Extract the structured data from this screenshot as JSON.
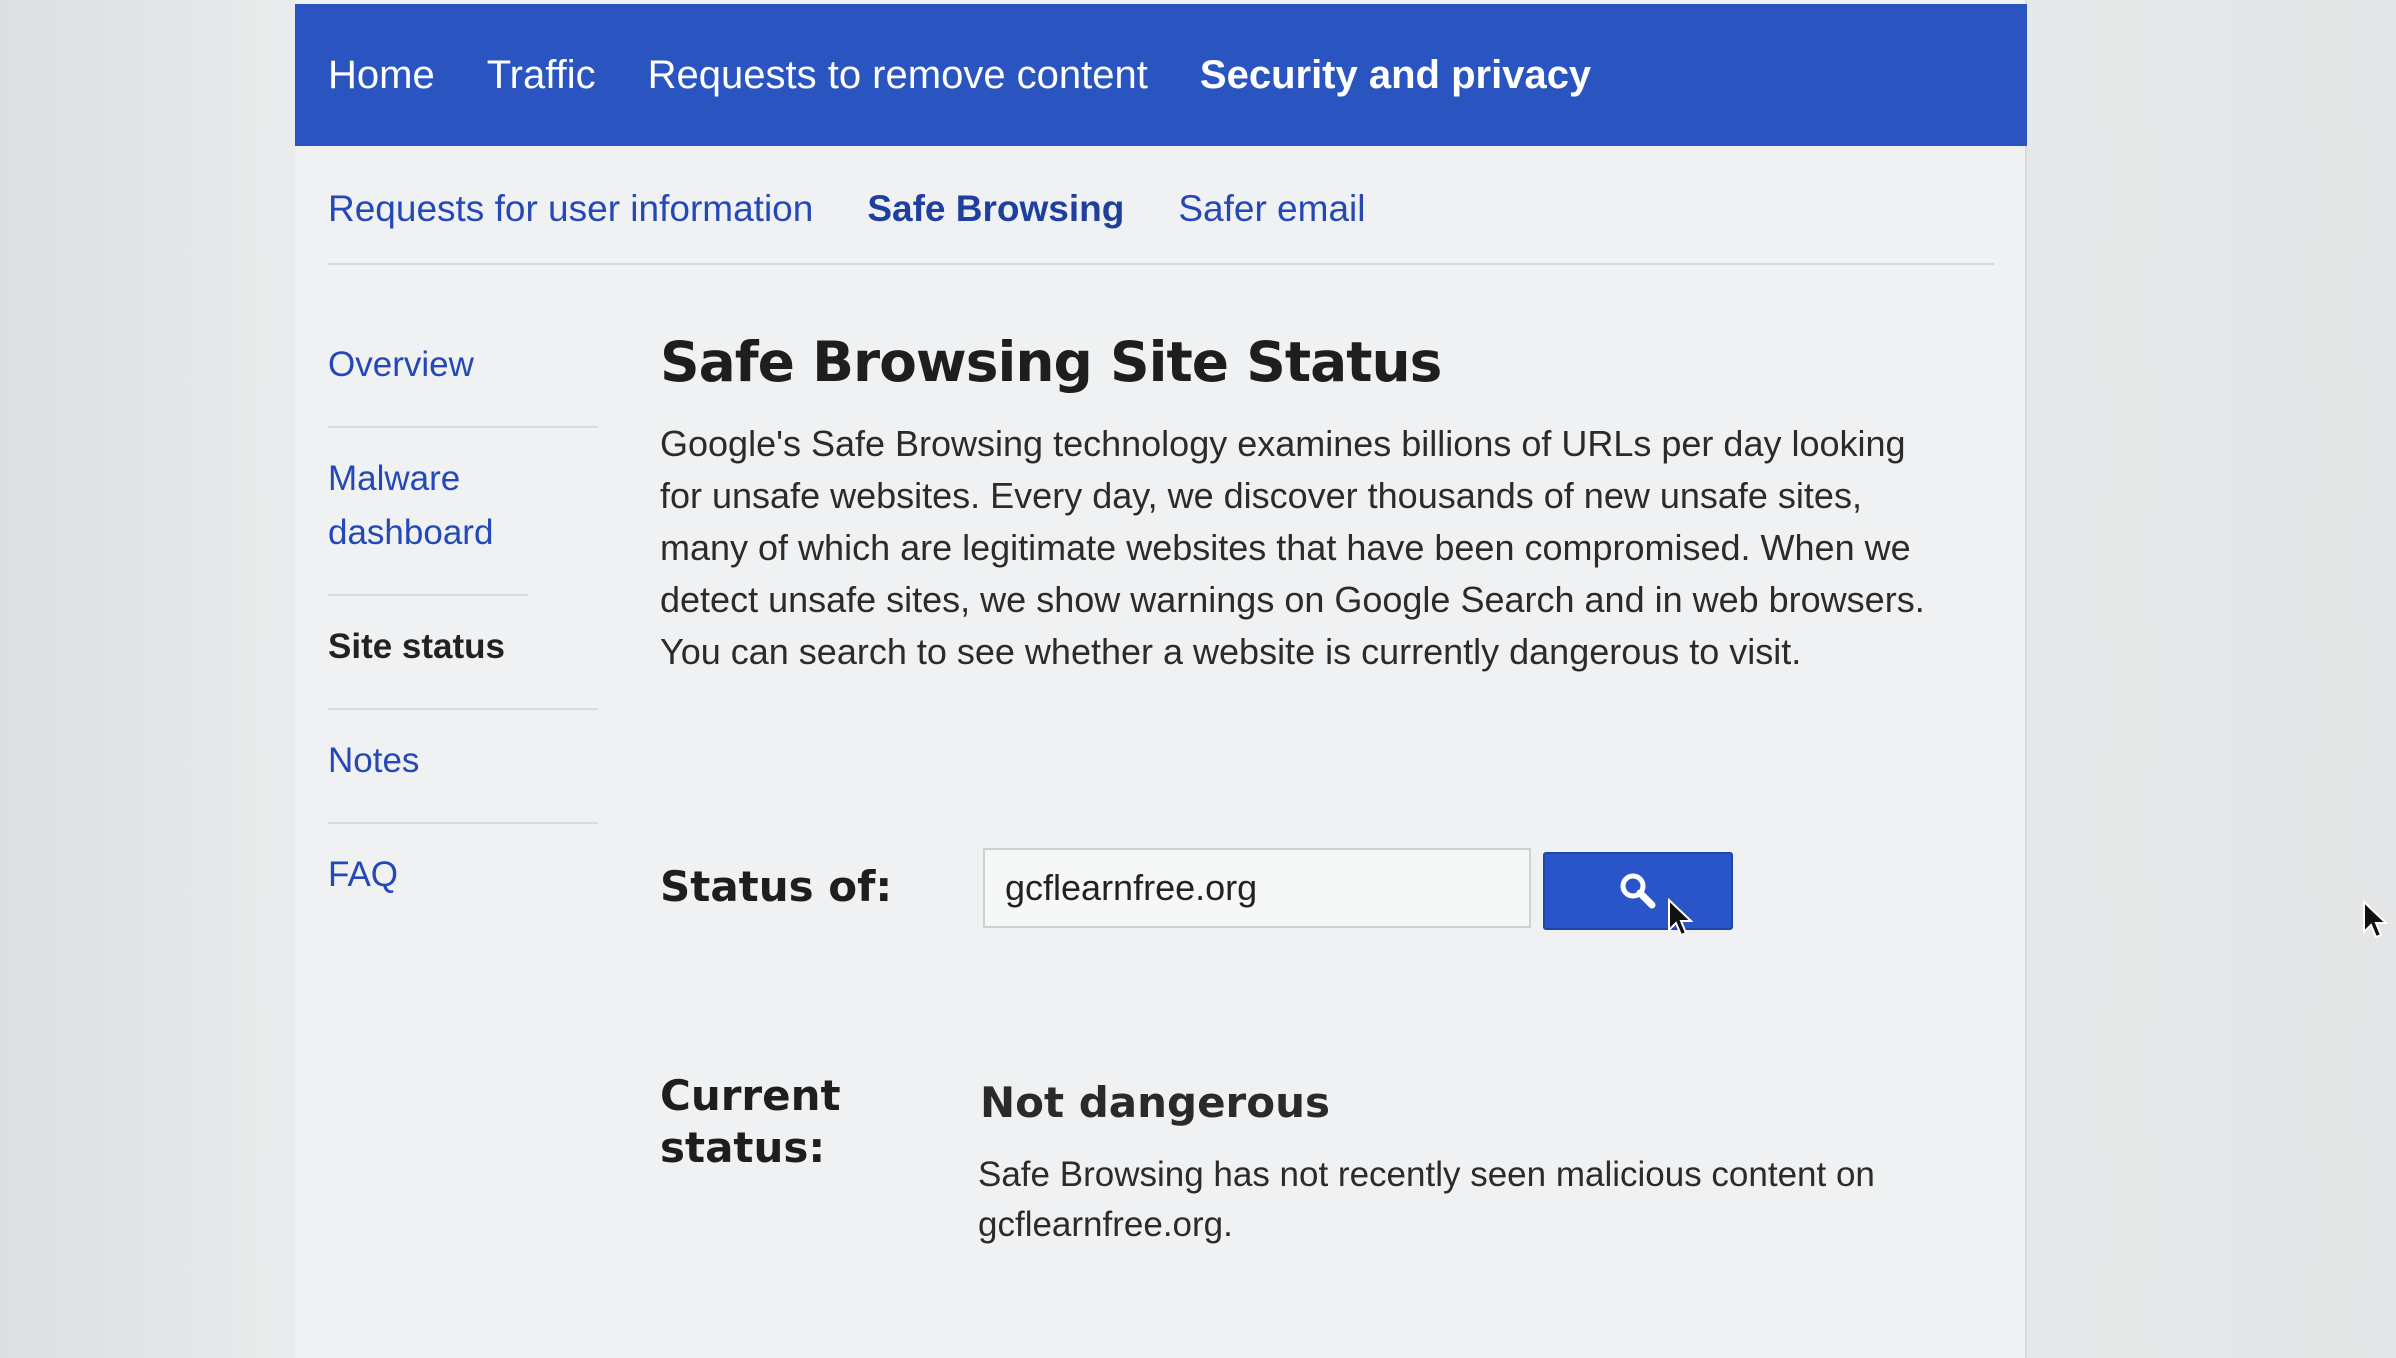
{
  "topnav": {
    "items": [
      {
        "label": "Home",
        "active": false
      },
      {
        "label": "Traffic",
        "active": false
      },
      {
        "label": "Requests to remove content",
        "active": false
      },
      {
        "label": "Security and privacy",
        "active": true
      }
    ]
  },
  "subnav": {
    "items": [
      {
        "label": "Requests for user information",
        "active": false
      },
      {
        "label": "Safe Browsing",
        "active": true
      },
      {
        "label": "Safer email",
        "active": false
      }
    ]
  },
  "sidebar": {
    "items": [
      {
        "label": "Overview"
      },
      {
        "label": "Malware dashboard"
      },
      {
        "label": "Site status",
        "current": true
      },
      {
        "label": "Notes"
      },
      {
        "label": "FAQ"
      }
    ]
  },
  "main": {
    "title": "Safe Browsing Site Status",
    "intro": "Google's Safe Browsing technology examines billions of URLs per day looking for unsafe websites. Every day, we discover thousands of new unsafe sites, many of which are legitimate websites that have been compromised. When we detect unsafe sites, we show warnings on Google Search and in web browsers. You can search to see whether a website is currently dangerous to visit.",
    "status_label": "Status of:",
    "status_value": "gcflearnfree.org",
    "search_icon": "search-icon",
    "current_label": "Current status:",
    "current_value": "Not dangerous",
    "current_desc": "Safe Browsing has not recently seen malicious content on gcflearnfree.org."
  },
  "colors": {
    "nav_bg": "#2a55c0",
    "link": "#2448b8",
    "button": "#2a55c8"
  }
}
